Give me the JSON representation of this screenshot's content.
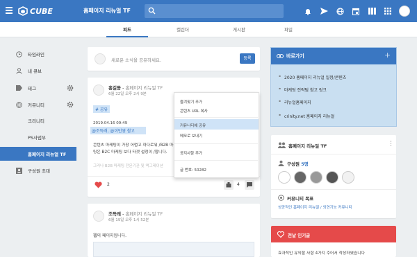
{
  "app": {
    "logo_text": "CUBE",
    "workspace": "홈페이지 리뉴얼 TF",
    "brand_color": "#3a77c2",
    "accent_red": "#e54a4a"
  },
  "tabs": [
    {
      "label": "피드"
    },
    {
      "label": "캘린더"
    },
    {
      "label": "게시판"
    },
    {
      "label": "파일"
    }
  ],
  "sidebar": {
    "items": [
      {
        "label": "타임라인",
        "icon": "clock-icon"
      },
      {
        "label": "내 큐브",
        "icon": "person-icon"
      },
      {
        "label": "태그",
        "icon": "tag-icon"
      },
      {
        "label": "커뮤니티",
        "icon": "globe-icon"
      },
      {
        "label": "크리니티"
      },
      {
        "label": "PS사업부"
      },
      {
        "label": "홈페이지 리뉴얼 TF",
        "active": true
      },
      {
        "label": "구성원 초대",
        "icon": "invite-icon"
      }
    ]
  },
  "composer": {
    "placeholder": "새로운 소식을 공유하세요.",
    "submit_label": "등록"
  },
  "post1": {
    "author": "홍길동",
    "sep": " - ",
    "group": "홈페이지 리뉴얼 TF",
    "date": "6월 22일 오후 2시 9분",
    "tag": "# 공유",
    "timestamp": "2019.04.16 09:49",
    "mentions": "@조득래, @이민영 참고",
    "body": "콘텐츠 마케팅이 가장 어렵고 까다로워 /B2B 마케팅은 B2C 마케팅 보다 타겟 설정이 /합니다.",
    "body_faded": "그러나 B2B 마케팅 전문기관 및 액그레이션",
    "likes": "2",
    "comments": "4"
  },
  "context_menu": {
    "items": [
      "즐겨찾기 추가",
      "콘텐츠 URL 복사",
      "커뮤니티에 공유",
      "메모로 보내기",
      "공지사항 추가",
      "글 번호: 50282"
    ]
  },
  "post2": {
    "author": "조득래",
    "sep": " - ",
    "group": "홈페이지 리뉴얼 TF",
    "date": "6월 19일 오후 1시 52분",
    "body": "웹의 페이지입니다."
  },
  "quick_links": {
    "title": "바로가기",
    "items": [
      "2020 홈페이지 리뉴얼 일정/콘텐츠",
      "마케팅 전략팀 참고 링크",
      "리뉴얼홈페이지",
      "crinity.net 홈페이지 리뉴얼"
    ]
  },
  "group_panel": {
    "name": "홈페이지 리뉴얼 TF",
    "members_label": "구성원",
    "members_count": "5명",
    "goal_label": "커뮤니티 목표",
    "goal_text": "성공적인 홈페이지 리뉴얼 / 외연기능 커뮤니티"
  },
  "popular": {
    "title": "전날 인기글",
    "preview": "효과적인 유의할 사항 4가지 주어서 작성하였습니다"
  }
}
